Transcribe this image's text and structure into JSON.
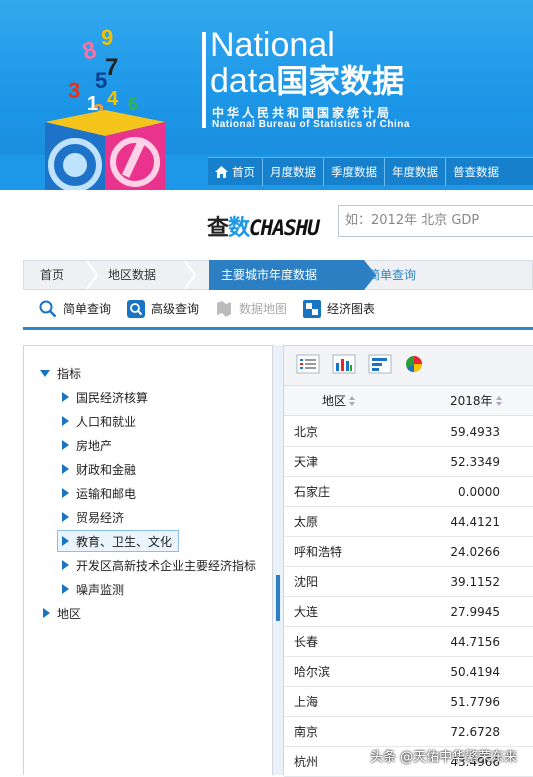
{
  "header": {
    "title_line1": "National",
    "title_line2_en": "data",
    "title_line2_cn": "国家数据",
    "subtitle_cn": "中华人民共和国国家统计局",
    "subtitle_en": "National Bureau of Statistics of China",
    "logo_digits": [
      "9",
      "8",
      "7",
      "5",
      "4",
      "3",
      "2",
      "1",
      "6"
    ],
    "nav": [
      "首页",
      "月度数据",
      "季度数据",
      "年度数据",
      "普查数据"
    ]
  },
  "search": {
    "brand_cn_1": "查",
    "brand_cn_2": "数",
    "brand_en": "CHASHU",
    "placeholder": "如：2012年 北京 GDP"
  },
  "breadcrumb": [
    "首页",
    "地区数据",
    "主要城市年度数据",
    "简单查询"
  ],
  "tools": [
    {
      "label": "简单查询",
      "icon": "search-icon"
    },
    {
      "label": "高级查询",
      "icon": "advanced-search-icon"
    },
    {
      "label": "数据地图",
      "icon": "map-icon"
    },
    {
      "label": "经济图表",
      "icon": "chart-icon"
    }
  ],
  "tree": {
    "root": "指标",
    "children": [
      "国民经济核算",
      "人口和就业",
      "房地产",
      "财政和金融",
      "运输和邮电",
      "贸易经济",
      "教育、卫生、文化",
      "开发区高新技术企业主要经济指标",
      "噪声监测"
    ],
    "selected": "教育、卫生、文化",
    "region_root": "地区"
  },
  "table": {
    "col_region": "地区",
    "col_year": "2018年",
    "rows": [
      {
        "region": "北京",
        "value": "59.4933"
      },
      {
        "region": "天津",
        "value": "52.3349"
      },
      {
        "region": "石家庄",
        "value": "0.0000"
      },
      {
        "region": "太原",
        "value": "44.4121"
      },
      {
        "region": "呼和浩特",
        "value": "24.0266"
      },
      {
        "region": "沈阳",
        "value": "39.1152"
      },
      {
        "region": "大连",
        "value": "27.9945"
      },
      {
        "region": "长春",
        "value": "44.7156"
      },
      {
        "region": "哈尔滨",
        "value": "50.4194"
      },
      {
        "region": "上海",
        "value": "51.7796"
      },
      {
        "region": "南京",
        "value": "72.6728"
      },
      {
        "region": "杭州",
        "value": "43.4966"
      }
    ]
  },
  "watermark": "头条 @天佑中华繁荣东来"
}
